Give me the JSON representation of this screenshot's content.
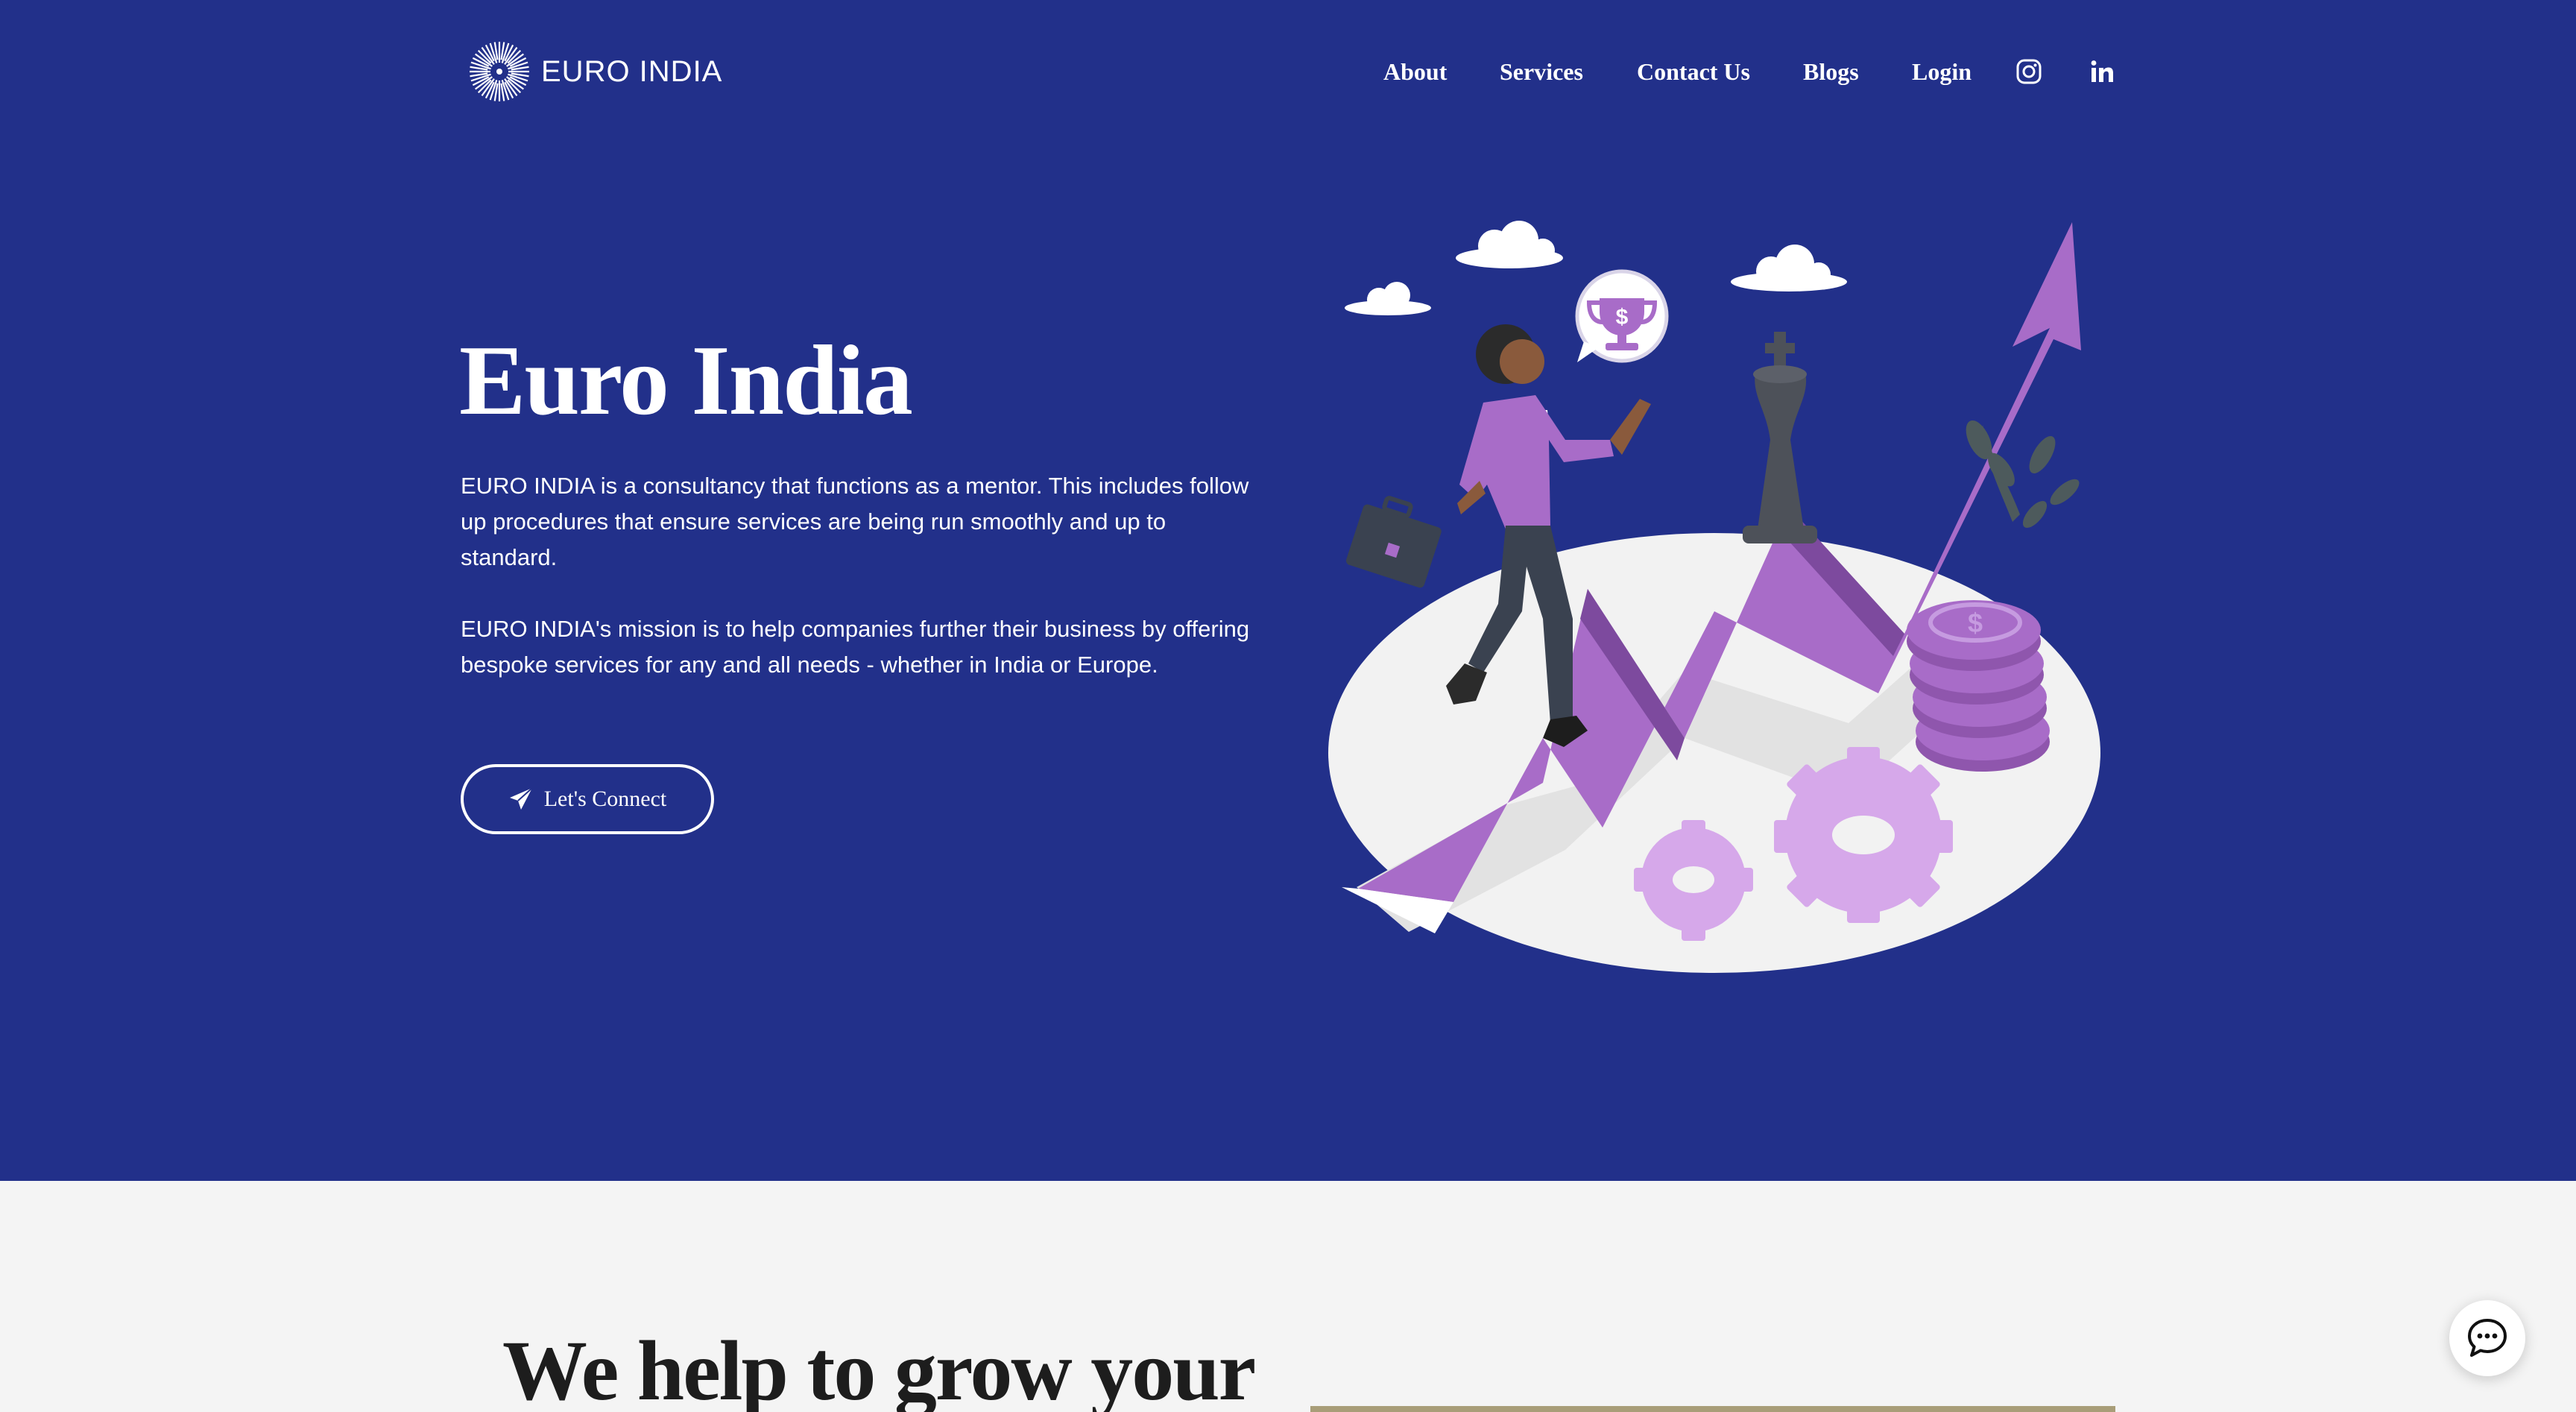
{
  "brand": {
    "name": "EURO INDIA",
    "logo_icon": "sunburst-logo-icon"
  },
  "nav": {
    "items": [
      {
        "label": "About"
      },
      {
        "label": "Services"
      },
      {
        "label": "Contact Us"
      },
      {
        "label": "Blogs"
      },
      {
        "label": "Login"
      }
    ],
    "social": [
      "instagram-icon",
      "linkedin-icon"
    ]
  },
  "hero": {
    "title": "Euro India",
    "paragraph_1": "EURO INDIA is a consultancy that functions as a mentor. This includes follow up procedures that ensure services are being run smoothly and up to standard.",
    "paragraph_2": "EURO INDIA's mission is to help companies further their business by offering bespoke services for any and all needs - whether in India or Europe.",
    "cta_label": "Let's Connect",
    "cta_icon": "paper-plane-icon"
  },
  "section2": {
    "heading": "We help to grow your"
  },
  "chat": {
    "icon": "chat-bubble-icon"
  },
  "colors": {
    "hero_bg": "#22308a",
    "accent_purple": "#a86cc8",
    "light_section_bg": "#f4f4f4",
    "text_white": "#ffffff",
    "text_dark": "#1d1d1d"
  }
}
